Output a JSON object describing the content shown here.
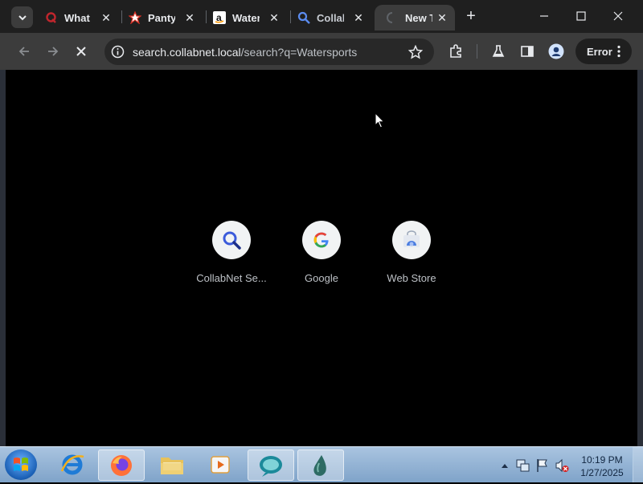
{
  "tabs": [
    {
      "title": "What",
      "icon": "quora-icon",
      "color": "#b92b27"
    },
    {
      "title": "Panty",
      "icon": "star-burst-icon",
      "color": "#d93025"
    },
    {
      "title": "Water",
      "icon": "amazon-icon",
      "color": "#ff9900"
    },
    {
      "title": "Collab",
      "icon": "search-magnifier-icon",
      "color": "#4285f4"
    },
    {
      "title": "New T",
      "icon": "loading-spinner-icon",
      "color": "#8ab4f8"
    }
  ],
  "omnibox": {
    "host": "search.collabnet.local",
    "path": "/search?q=Watersports"
  },
  "profile_chip": {
    "label": "Error"
  },
  "shortcuts": [
    {
      "label": "CollabNet Se...",
      "icon": "search-magnifier-icon"
    },
    {
      "label": "Google",
      "icon": "google-g-icon"
    },
    {
      "label": "Web Store",
      "icon": "web-store-icon"
    }
  ],
  "clock": {
    "time": "10:19 PM",
    "date": "1/27/2025"
  },
  "colors": {
    "tab_strip": "#1f1f1f",
    "toolbar": "#3c3c3c",
    "omnibox": "#282828",
    "content_bg": "#000000",
    "taskbar": "#7fa3c9"
  }
}
